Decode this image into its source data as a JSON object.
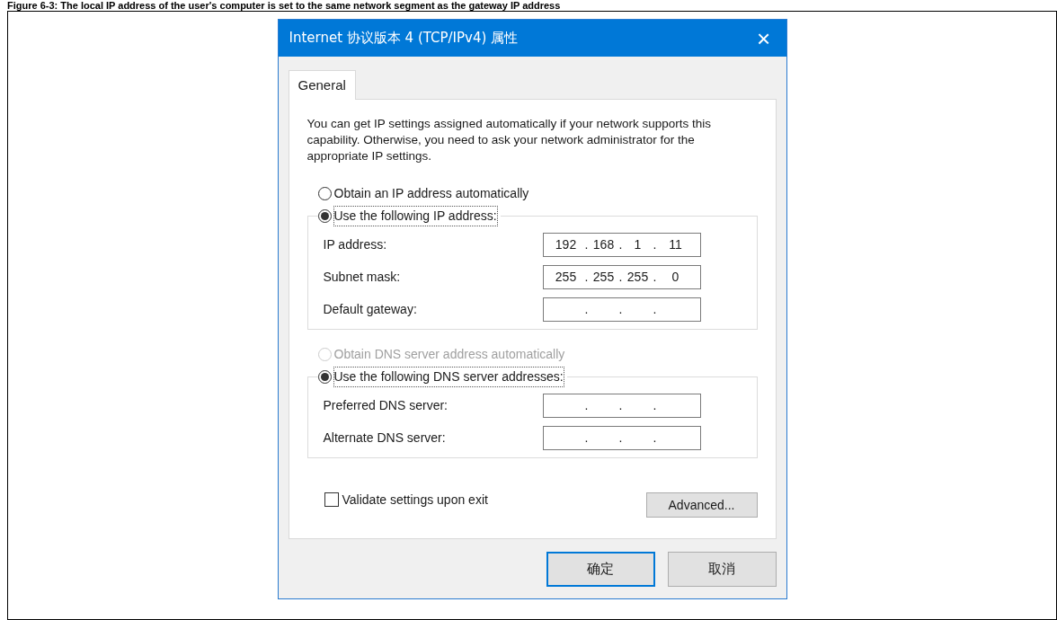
{
  "caption": "Figure 6-3: The local IP address of the user's computer is set to the same network segment as the gateway IP address",
  "window": {
    "title": "Internet 协议版本 4 (TCP/IPv4) 属性",
    "close": "×"
  },
  "tabs": [
    {
      "label": "General",
      "selected": true
    }
  ],
  "intro": "You can get IP settings assigned automatically if your network supports this capability. Otherwise, you need to ask your network administrator for the appropriate IP settings.",
  "ip_group": {
    "options": [
      {
        "label": "Obtain an IP address automatically",
        "selected": false,
        "disabled": false
      },
      {
        "label": "Use the following IP address:",
        "selected": true,
        "disabled": false
      }
    ],
    "fields": [
      {
        "label": "IP address:",
        "octets": [
          "192",
          "168",
          "1",
          "11"
        ],
        "dots": [
          ".",
          ".",
          "."
        ]
      },
      {
        "label": "Subnet mask:",
        "octets": [
          "255",
          "255",
          "255",
          "0"
        ],
        "dots": [
          ".",
          ".",
          "."
        ]
      },
      {
        "label": "Default gateway:",
        "dots": [
          ".",
          ".",
          "."
        ]
      }
    ]
  },
  "dns_group": {
    "options": [
      {
        "label": "Obtain DNS server address automatically",
        "selected": false,
        "disabled": true
      },
      {
        "label": "Use the following DNS server addresses:",
        "selected": true,
        "disabled": false
      }
    ],
    "fields": [
      {
        "label": "Preferred DNS server:",
        "dots": [
          ".",
          ".",
          "."
        ]
      },
      {
        "label": "Alternate DNS server:",
        "dots": [
          ".",
          ".",
          "."
        ]
      }
    ]
  },
  "validate": {
    "label": "Validate settings upon exit",
    "checked": false
  },
  "advanced_button": "Advanced...",
  "buttons": [
    {
      "label": "确定",
      "default": true
    },
    {
      "label": "取消",
      "default": false
    }
  ]
}
